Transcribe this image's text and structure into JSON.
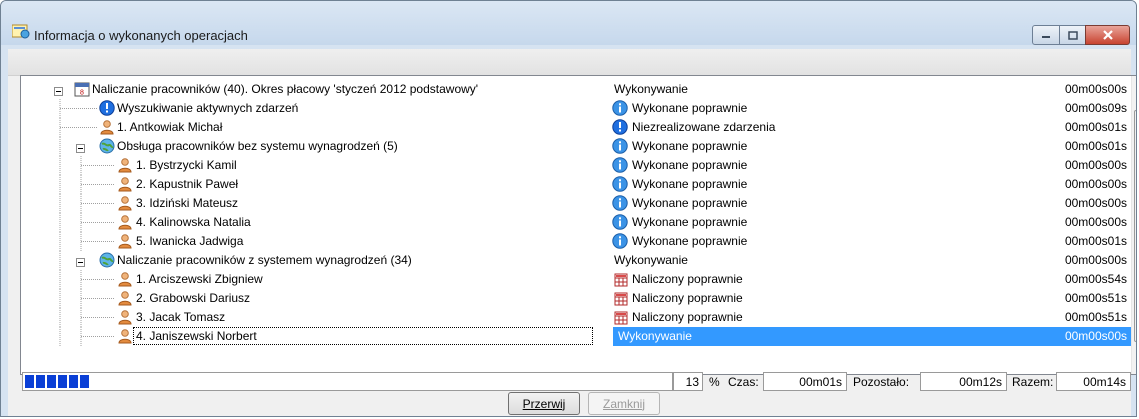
{
  "window": {
    "title": "Informacja o wykonanych operacjach"
  },
  "tree": [
    {
      "label": "Naliczanie pracowników (40). Okres płacowy 'styczeń 2012 podstawowy'",
      "status": "Wykonywanie",
      "time": "00m00s00s",
      "icon": "calendar-icon",
      "status_icon": "none",
      "level": 0,
      "expander": "minus"
    },
    {
      "label": "Wyszukiwanie aktywnych zdarzeń",
      "status": "Wykonane poprawnie",
      "time": "00m00s09s",
      "icon": "blue-exclamation-icon",
      "status_icon": "info-icon",
      "level": 1,
      "expander": "none"
    },
    {
      "label": "1. Antkowiak Michał",
      "status": "Niezrealizowane zdarzenia",
      "time": "00m00s01s",
      "icon": "person-icon",
      "status_icon": "blue-exclamation-icon",
      "level": 1,
      "expander": "none"
    },
    {
      "label": "Obsługa pracowników bez systemu wynagrodzeń (5)",
      "status": "Wykonane poprawnie",
      "time": "00m00s01s",
      "icon": "globe-icon",
      "status_icon": "info-icon",
      "level": 1,
      "expander": "minus"
    },
    {
      "label": "1. Bystrzycki Kamil",
      "status": "Wykonane poprawnie",
      "time": "00m00s00s",
      "icon": "person-icon",
      "status_icon": "info-icon",
      "level": 2,
      "expander": "none"
    },
    {
      "label": "2. Kapustnik Paweł",
      "status": "Wykonane poprawnie",
      "time": "00m00s00s",
      "icon": "person-icon",
      "status_icon": "info-icon",
      "level": 2,
      "expander": "none"
    },
    {
      "label": "3. Idziński Mateusz",
      "status": "Wykonane poprawnie",
      "time": "00m00s00s",
      "icon": "person-icon",
      "status_icon": "info-icon",
      "level": 2,
      "expander": "none"
    },
    {
      "label": "4. Kalinowska Natalia",
      "status": "Wykonane poprawnie",
      "time": "00m00s00s",
      "icon": "person-icon",
      "status_icon": "info-icon",
      "level": 2,
      "expander": "none"
    },
    {
      "label": "5. Iwanicka Jadwiga",
      "status": "Wykonane poprawnie",
      "time": "00m00s01s",
      "icon": "person-icon",
      "status_icon": "info-icon",
      "level": 2,
      "expander": "none"
    },
    {
      "label": "Naliczanie pracowników z systemem wynagrodzeń (34)",
      "status": "Wykonywanie",
      "time": "00m00s00s",
      "icon": "globe-icon",
      "status_icon": "none",
      "level": 1,
      "expander": "minus"
    },
    {
      "label": "1. Arciszewski Zbigniew",
      "status": "Naliczony poprawnie",
      "time": "00m00s54s",
      "icon": "person-icon",
      "status_icon": "calculator-icon",
      "level": 2,
      "expander": "none"
    },
    {
      "label": "2. Grabowski Dariusz",
      "status": "Naliczony poprawnie",
      "time": "00m00s51s",
      "icon": "person-icon",
      "status_icon": "calculator-icon",
      "level": 2,
      "expander": "none"
    },
    {
      "label": "3. Jacak Tomasz",
      "status": "Naliczony poprawnie",
      "time": "00m00s51s",
      "icon": "person-icon",
      "status_icon": "calculator-icon",
      "level": 2,
      "expander": "none"
    },
    {
      "label": "4. Janiszewski Norbert",
      "status": "Wykonywanie",
      "time": "00m00s00s",
      "icon": "person-icon",
      "status_icon": "none",
      "level": 2,
      "expander": "none",
      "selected": true
    }
  ],
  "footer": {
    "progress_fraction": 0.13,
    "percent_value": "13",
    "percent_sign": "%",
    "czas_label": "Czas:",
    "czas_value": "00m01s",
    "pozostalo_label": "Pozostało:",
    "pozostalo_value": "00m12s",
    "razem_label": "Razem:",
    "razem_value": "00m14s"
  },
  "buttons": {
    "przerwij": "Przerwij",
    "zamknij": "Zamknij"
  },
  "colors": {
    "selection": "#3399ff",
    "progress": "#0a3fd6"
  }
}
